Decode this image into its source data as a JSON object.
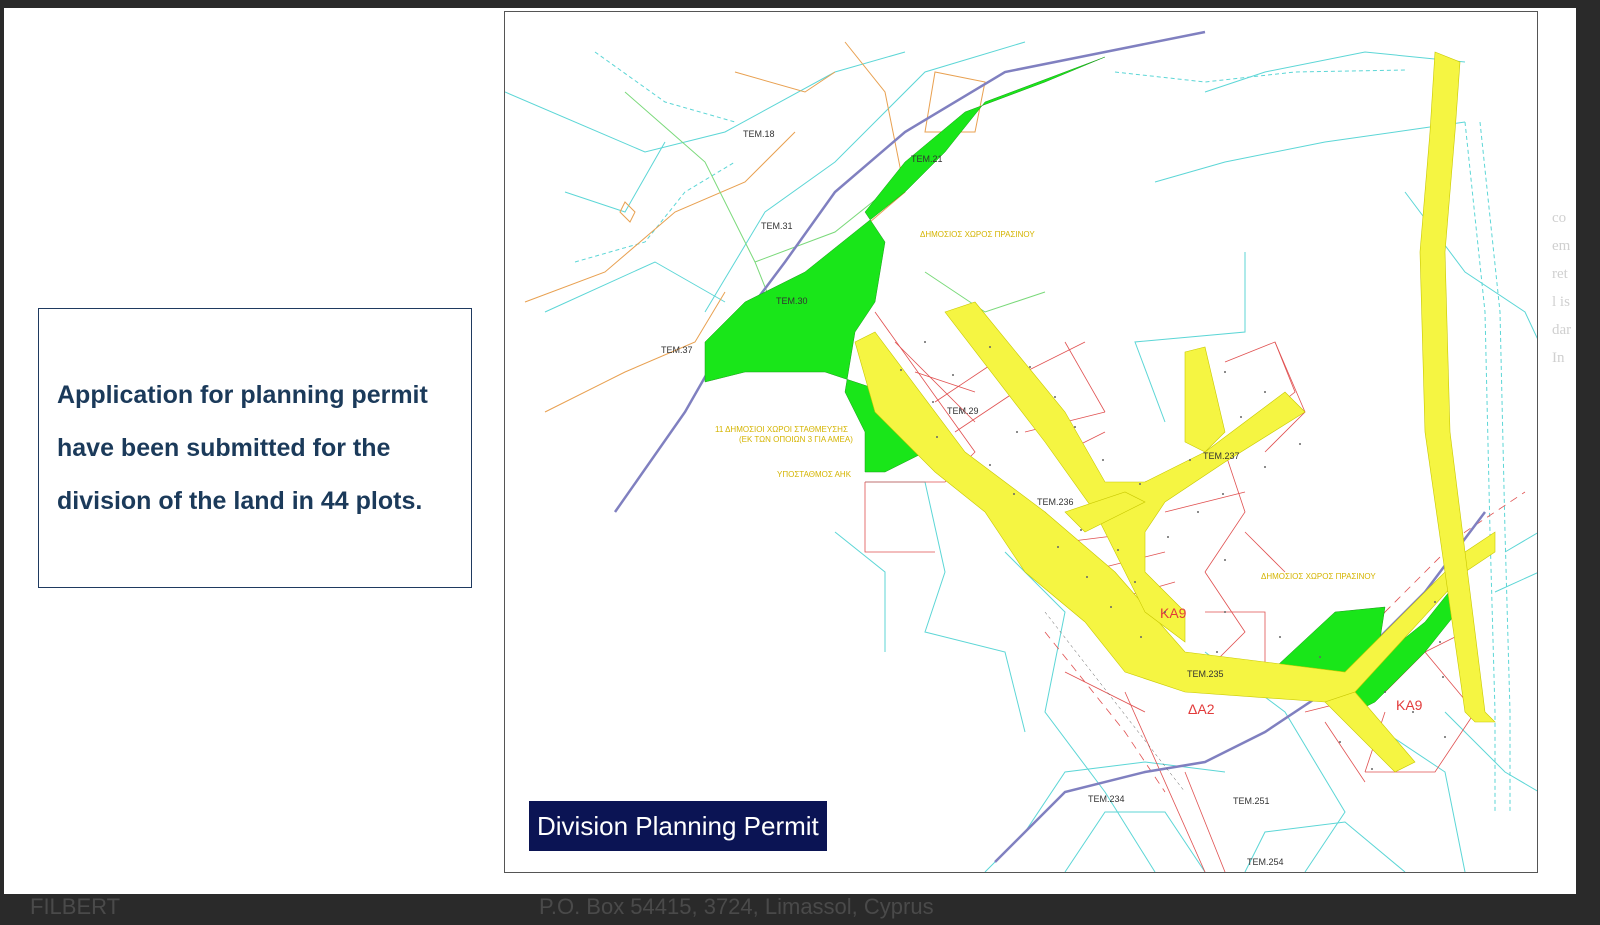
{
  "info_box": {
    "text": "Application for planning permit have been submitted for the division of the land in 44 plots."
  },
  "map": {
    "caption": "Division Planning Permit",
    "labels": {
      "tem18": "TEM.18",
      "tem21": "TEM.21",
      "tem31": "TEM.31",
      "tem30": "TEM.30",
      "tem37": "TEM.37",
      "tem29": "TEM.29",
      "tem236": "TEM.236",
      "tem237": "TEM.237",
      "tem235": "TEM.235",
      "tem234": "TEM.234",
      "tem251": "TEM.251",
      "tem254": "TEM.254",
      "zone_ka9_a": "KA9",
      "zone_ka9_b": "KA9",
      "zone_da2": "ΔΑ2",
      "green_space_1": "ΔΗΜΟΣΙΟΣ ΧΩΡΟΣ ΠΡΑΣΙΝΟΥ",
      "green_space_2": "ΔΗΜΟΣΙΟΣ ΧΩΡΟΣ ΠΡΑΣΙΝΟΥ",
      "parking_1": "11 ΔΗΜΟΣΙΟΙ ΧΩΡΟΙ ΣΤΑΘΜΕΥΣΗΣ",
      "parking_2": "(ΕΚ ΤΩΝ ΟΠΟΙΩΝ 3 ΓΙΑ ΑΜΕΑ)",
      "substation": "ΥΠΟΣΤΑΘΜΟΣ ΑΗΚ"
    }
  },
  "footer": {
    "left": "FILBERT",
    "right": "P.O. Box 54415, 3724, Limassol, Cyprus"
  },
  "background_text": {
    "line1": "co",
    "line2": "em",
    "line3": "ret",
    "line4": "l is",
    "line5": "dar",
    "line6": "In"
  },
  "colors": {
    "green": "#19e619",
    "yellow": "#f5f542",
    "caption_bg": "#0b1454",
    "info_text": "#1b3a5a"
  }
}
